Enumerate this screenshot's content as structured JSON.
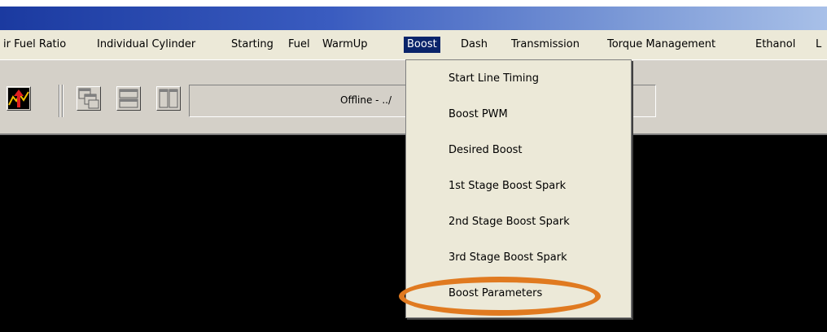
{
  "menu": {
    "items": [
      {
        "label": "ir Fuel Ratio"
      },
      {
        "label": "Individual Cylinder"
      },
      {
        "label": "Starting"
      },
      {
        "label": "Fuel"
      },
      {
        "label": "WarmUp"
      },
      {
        "label": "Boost"
      },
      {
        "label": "Dash"
      },
      {
        "label": "Transmission"
      },
      {
        "label": "Torque Management"
      },
      {
        "label": "Ethanol"
      },
      {
        "label": "L"
      }
    ],
    "active": "Boost"
  },
  "toolbar": {
    "status_text": "Offline - ../",
    "icons": [
      "tune-graph-icon",
      "cascade-windows-icon",
      "tile-horizontal-icon",
      "tile-vertical-icon"
    ]
  },
  "boost_menu": {
    "items": [
      {
        "label": "Start Line Timing"
      },
      {
        "label": "Boost PWM"
      },
      {
        "label": "Desired Boost"
      },
      {
        "label": "1st Stage Boost Spark"
      },
      {
        "label": "2nd Stage Boost Spark"
      },
      {
        "label": "3rd Stage Boost Spark"
      },
      {
        "label": "Boost Parameters"
      }
    ],
    "highlighted": "Boost Parameters"
  },
  "colors": {
    "highlight_ring": "#e07a20",
    "menu_selected": "#0a246a",
    "workspace": "#000000"
  }
}
